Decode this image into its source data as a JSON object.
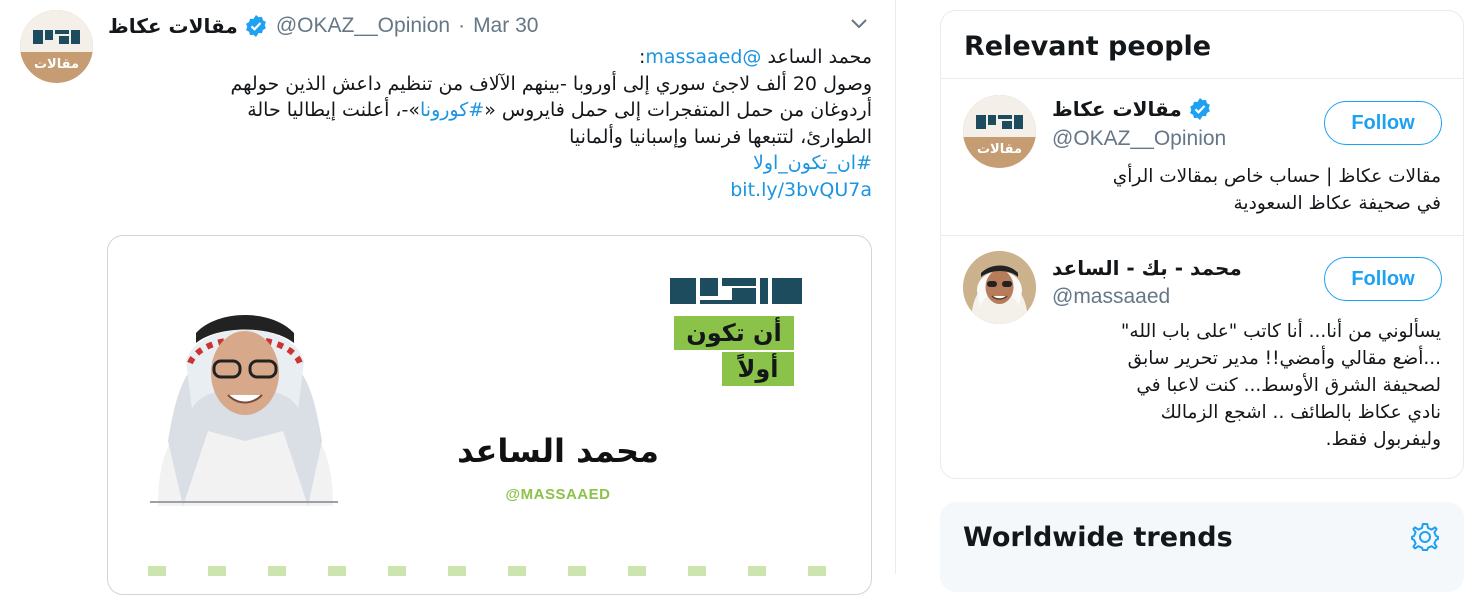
{
  "tweet": {
    "author_name": "مقالات عكاظ",
    "handle": "@OKAZ__Opinion",
    "separator": "·",
    "date": "Mar 30",
    "avatar_label": "مقالات",
    "text": {
      "line1_name": "محمد الساعد",
      "line1_mention": "@massaaed",
      "line1_colon": ":",
      "line2": "وصول 20 ألف لاجئ سوري إلى أوروبا -بينهم الآلاف من تنظيم داعش الذين حولهم",
      "line3_before": "أردوغان من حمل المتفجرات إلى حمل فايروس «",
      "line3_hashtag": "#كورونا",
      "line3_after": "»-، أعلنت إيطاليا حالة",
      "line4": "الطوارئ، لتتبعها فرنسا وإسبانيا وألمانيا",
      "hashtag": "#ان_تكون_اولا",
      "link": "bit.ly/3bvQU7a"
    },
    "media": {
      "brand": "عكاظ",
      "tagline_1": "أن تكون",
      "tagline_2": "أولاً",
      "writer_name": "محمد الساعد",
      "writer_handle": "@MASSAAED"
    }
  },
  "sidebar": {
    "relevant_title": "Relevant people",
    "people": [
      {
        "name": "مقالات عكاظ",
        "handle": "@OKAZ__Opinion",
        "follow_label": "Follow",
        "avatar_label": "مقالات",
        "bio_lines": [
          "مقالات عكاظ | حساب خاص بمقالات الرأي",
          "في صحيفة عكاظ السعودية"
        ]
      },
      {
        "name": "محمد - بك - الساعد",
        "handle": "@massaaed",
        "follow_label": "Follow",
        "bio_lines": [
          "يسألوني من أنا... أنا كاتب \"على باب الله\"",
          "...أضع مقالي وأمضي!! مدير تحرير سابق",
          "لصحيفة الشرق الأوسط... كنت لاعبا في",
          "نادي عكاظ بالطائف .. اشجع الزمالك",
          "وليفربول فقط."
        ]
      }
    ],
    "trends_title": "Worldwide trends"
  },
  "colors": {
    "accent": "#1da1f2",
    "link": "#1b95e0",
    "secondary_text": "#657786",
    "brand_green": "#8bc34a",
    "avatar_brown": "#c69c72"
  },
  "icons": {
    "verified": "verified-badge-icon",
    "caret": "chevron-down-icon",
    "settings": "gear-icon"
  }
}
